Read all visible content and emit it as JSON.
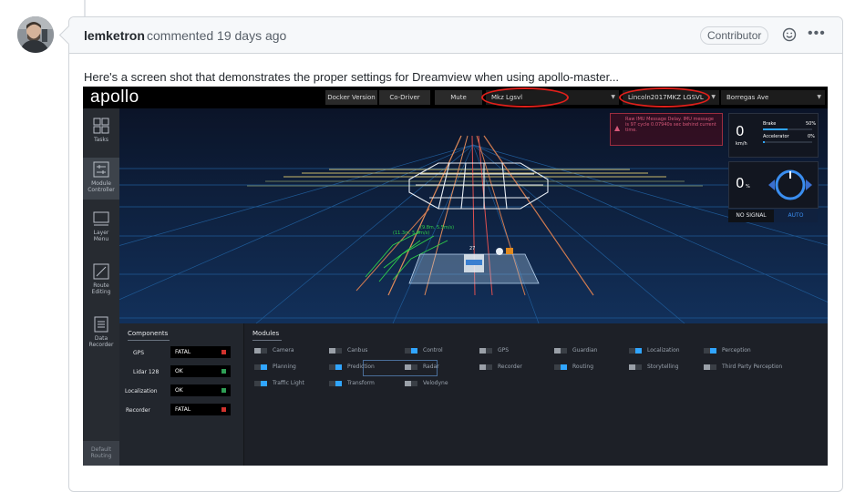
{
  "comment": {
    "author": "lemketron",
    "meta": "commented 19 days ago",
    "badge": "Contributor",
    "more_icon": "kebab-horizontal-icon",
    "reaction_icon": "smiley-icon",
    "body": "Here's a screen shot that demonstrates the proper settings for Dreamview when using apollo-master..."
  },
  "dreamview": {
    "logo": "apollo",
    "toolbar": {
      "docker_version": "Docker Version",
      "co_driver": "Co-Driver",
      "mute": "Mute",
      "mode_select": "Mkz Lgsvl",
      "vehicle_select": "Lincoln2017MKZ LGSVL",
      "map_select": "Borregas Ave"
    },
    "sidebar": [
      {
        "label": "Tasks",
        "icon": "tasks-icon"
      },
      {
        "label": "Module Controller",
        "icon": "module-controller-icon"
      },
      {
        "label": "Layer Menu",
        "icon": "layer-menu-icon"
      },
      {
        "label": "Route Editing",
        "icon": "route-editing-icon"
      },
      {
        "label": "Data Recorder",
        "icon": "data-recorder-icon"
      }
    ],
    "default_routing": "Default Routing",
    "alert": "Raw IMU Message Delay. IMU message is 97 cycle 0.07940s sec behind current time.",
    "speed": {
      "value": "0",
      "unit": "km/h"
    },
    "brake": {
      "label": "Brake",
      "value": "50%",
      "fraction": 0.5
    },
    "accelerator": {
      "label": "Accelerator",
      "value": "0%",
      "fraction": 0.0
    },
    "steering": {
      "value": "0",
      "unit": "%"
    },
    "signal": {
      "left": "NO SIGNAL",
      "right": "AUTO"
    },
    "scene_labels": {
      "label_a": "27",
      "label_b": "(11.3m, 5.9m/s)",
      "label_c": "(9.8m, 5.5m/s)"
    },
    "components": {
      "title": "Components",
      "items": [
        {
          "name": "GPS",
          "value": "FATAL",
          "color": "#d0322d"
        },
        {
          "name": "Lidar 128",
          "value": "OK",
          "color": "#2e9e55"
        },
        {
          "name": "Localization",
          "value": "OK",
          "color": "#2e9e55"
        },
        {
          "name": "Recorder",
          "value": "FATAL",
          "color": "#d0322d"
        }
      ]
    },
    "modules": {
      "title": "Modules",
      "items": [
        {
          "name": "Camera",
          "on": false
        },
        {
          "name": "Canbus",
          "on": false
        },
        {
          "name": "Control",
          "on": true
        },
        {
          "name": "GPS",
          "on": false
        },
        {
          "name": "Guardian",
          "on": false
        },
        {
          "name": "Localization",
          "on": true
        },
        {
          "name": "Perception",
          "on": true
        },
        {
          "name": "Planning",
          "on": true
        },
        {
          "name": "Prediction",
          "on": true
        },
        {
          "name": "Radar",
          "on": false
        },
        {
          "name": "Recorder",
          "on": false
        },
        {
          "name": "Routing",
          "on": true
        },
        {
          "name": "Storytelling",
          "on": false
        },
        {
          "name": "Third Party Perception",
          "on": false
        },
        {
          "name": "Traffic Light",
          "on": true
        },
        {
          "name": "Transform",
          "on": true
        },
        {
          "name": "Velodyne",
          "on": false
        }
      ]
    }
  }
}
